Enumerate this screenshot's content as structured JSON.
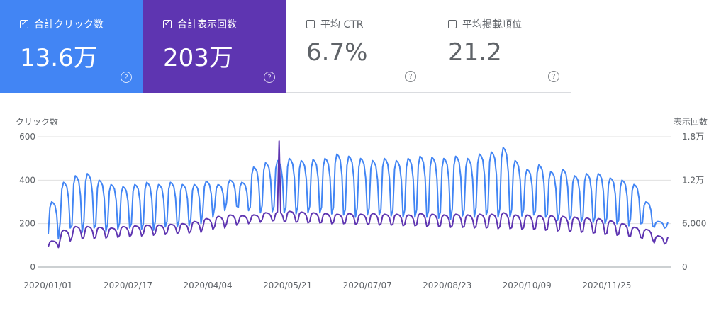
{
  "metrics": [
    {
      "label": "合計クリック数",
      "value": "13.6万",
      "checked": true,
      "color": "#4285f4"
    },
    {
      "label": "合計表示回数",
      "value": "203万",
      "checked": true,
      "color": "#5e35b1"
    },
    {
      "label": "平均 CTR",
      "value": "6.7%",
      "checked": false
    },
    {
      "label": "平均掲載順位",
      "value": "21.2",
      "checked": false
    }
  ],
  "chart_data": {
    "type": "line",
    "ylabel_left": "クリック数",
    "ylabel_right": "表示回数",
    "y_left_ticks": [
      "600",
      "400",
      "200",
      "0"
    ],
    "y_right_ticks": [
      "1.8万",
      "1.2万",
      "6,000",
      "0"
    ],
    "ylim_left": [
      0,
      600
    ],
    "ylim_right": [
      0,
      18000
    ],
    "x_ticks": [
      "2020/01/01",
      "2020/02/17",
      "2020/04/04",
      "2020/05/21",
      "2020/07/07",
      "2020/08/23",
      "2020/10/09",
      "2020/11/25"
    ],
    "x_range": [
      "2020-01-01",
      "2020-12-31"
    ],
    "grid": true,
    "series": [
      {
        "name": "クリック数",
        "axis": "left",
        "color": "#4285f4",
        "weekly_low": [
          130,
          180,
          160,
          180,
          165,
          175,
          180,
          175,
          170,
          185,
          185,
          190,
          200,
          230,
          260,
          280,
          260,
          250,
          255,
          250,
          245,
          250,
          250,
          245,
          240,
          230,
          240,
          240,
          235,
          230,
          230,
          230,
          225,
          220,
          235,
          230,
          240,
          230,
          230,
          235,
          240,
          230,
          215,
          220,
          210,
          205,
          200,
          200,
          190,
          200,
          190,
          180
        ],
        "weekly_high": [
          300,
          390,
          420,
          430,
          400,
          380,
          370,
          380,
          390,
          380,
          390,
          380,
          380,
          395,
          380,
          400,
          390,
          460,
          480,
          490,
          500,
          490,
          495,
          500,
          520,
          510,
          500,
          490,
          500,
          490,
          500,
          510,
          505,
          500,
          510,
          500,
          520,
          530,
          550,
          490,
          450,
          470,
          440,
          450,
          420,
          430,
          430,
          410,
          400,
          380,
          300,
          210
        ]
      },
      {
        "name": "表示回数",
        "axis": "right",
        "color": "#5e35b1",
        "weekly_low": [
          2700,
          3600,
          3900,
          3900,
          4000,
          4100,
          4200,
          4300,
          4400,
          4500,
          4600,
          4700,
          4800,
          5200,
          5400,
          5800,
          6000,
          6200,
          6400,
          6300,
          6200,
          6100,
          6100,
          6000,
          6000,
          5900,
          5900,
          5800,
          5800,
          5700,
          5700,
          5600,
          5600,
          5500,
          5500,
          5400,
          5400,
          5300,
          5300,
          5200,
          5200,
          5100,
          5000,
          4900,
          4800,
          4700,
          4500,
          4400,
          4300,
          4100,
          3800,
          3200
        ],
        "weekly_high": [
          3600,
          5100,
          5600,
          5600,
          5500,
          5400,
          5600,
          5700,
          5800,
          5800,
          5900,
          6000,
          6300,
          6700,
          7000,
          7200,
          7100,
          7200,
          7500,
          7600,
          7700,
          7600,
          7500,
          7400,
          7300,
          7400,
          7300,
          7400,
          7300,
          7300,
          7200,
          7400,
          7300,
          7200,
          7300,
          7200,
          7300,
          7300,
          7500,
          7200,
          7200,
          7100,
          7100,
          7000,
          6900,
          6800,
          6700,
          6400,
          6000,
          5500,
          5200,
          4300
        ],
        "spike": {
          "date": "2020-05-16",
          "value": 17400
        }
      }
    ]
  }
}
